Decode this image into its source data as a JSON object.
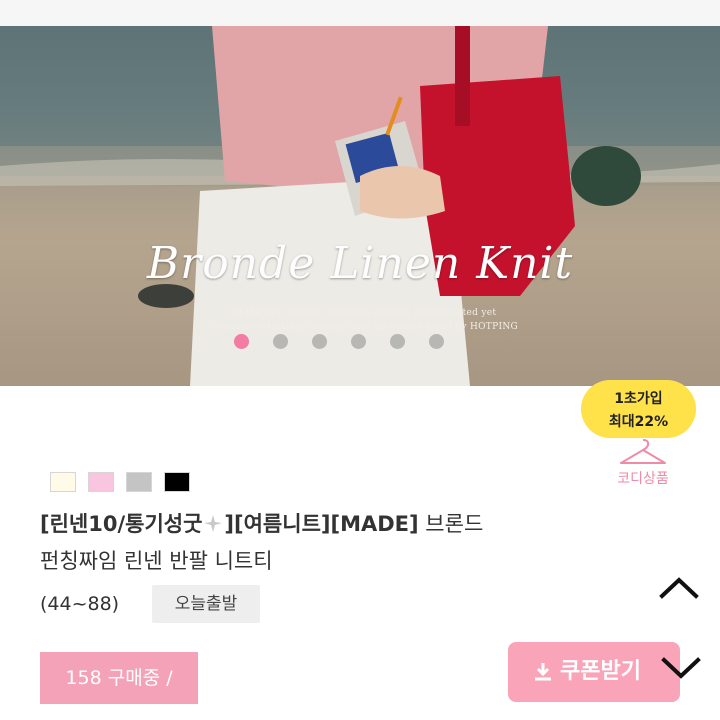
{
  "banner": {
    "title": "Bronde Linen Knit",
    "subtitle_line1": "in the new season, cardigan suggest sophisticated yet",
    "subtitle_line2": "urban coordination clothing that all women loved by HOTPING",
    "slide_count": 6,
    "active_slide": 1
  },
  "signup_promo": {
    "line1": "1초가입",
    "line2": "최대22%"
  },
  "codi": {
    "label": "코디상품"
  },
  "colors": {
    "swatches": [
      "#fffbe8",
      "#f9c5df",
      "#c4c4c4",
      "#000000"
    ],
    "accent_pink": "#f3a2b7",
    "promo_yellow": "#ffe14a"
  },
  "product": {
    "title_bold": "[린넨10/통기성굿",
    "title_bold_tail": "][여름니트][MADE]",
    "title_rest": " 브론드",
    "title_line2": "펀칭짜임 린넨 반팔 니트티",
    "sizes": "(44~88)",
    "shipping_badge": "오늘출발"
  },
  "actions": {
    "buyers": "158 구매중 /",
    "coupon": "쿠폰받기"
  }
}
